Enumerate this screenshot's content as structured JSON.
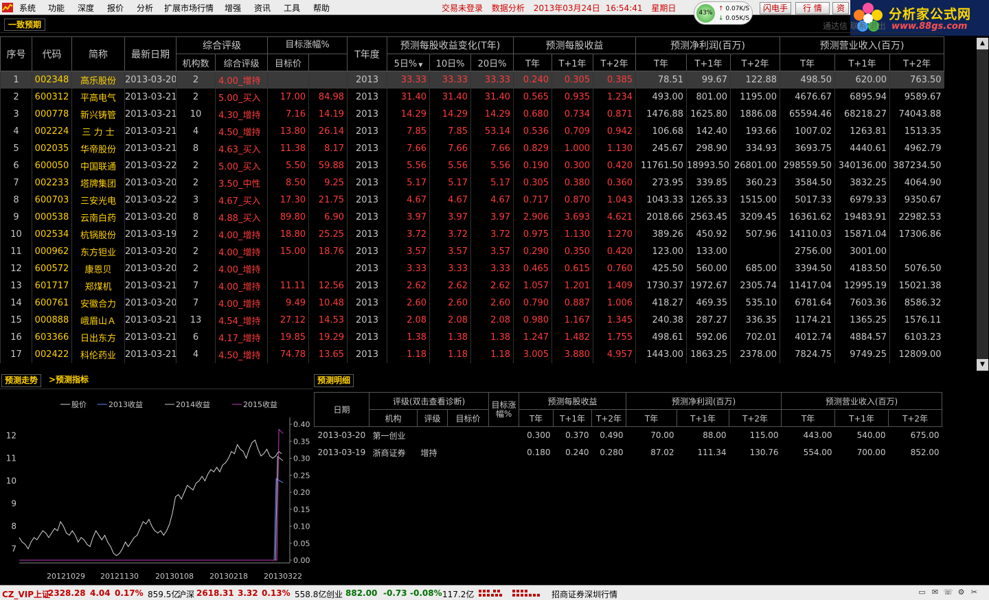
{
  "menu": [
    "系统",
    "功能",
    "深度",
    "报价",
    "分析",
    "扩展市场行情",
    "增强",
    "资讯",
    "工具",
    "帮助"
  ],
  "top_status": {
    "login": "交易未登录",
    "mode": "数据分析",
    "date": "2013年03月24日",
    "time": "16:54:41",
    "weekday": "星期日"
  },
  "network": {
    "percent": "43%",
    "up": "0.07K/S",
    "down": "0.05K/S"
  },
  "top_buttons": [
    "闪电手",
    "行 情",
    "资"
  ],
  "brand": {
    "name": "分析家公式网",
    "url": "www.88gs.com"
  },
  "top_right_links": "通达信 联系 退出",
  "panel_title": "一致预期",
  "table_headers": {
    "seq": "序号",
    "code": "代码",
    "name": "简称",
    "date": "最新日期",
    "rating": "综合评级",
    "target": "目标涨幅%",
    "tyear": "T年度",
    "eps_change": "预测每股收益变化(T年)",
    "eps": "预测每股收益",
    "net_profit": "预测净利润(百万)",
    "revenue": "预测营业收入(百万)",
    "institutions": "机构数",
    "rating_sub": "综合评级",
    "target_price": "目标价",
    "d5": "5日%",
    "d10": "10日%",
    "d20": "20日%",
    "t": "T年",
    "t1": "T+1年",
    "t2": "T+2年"
  },
  "rows": [
    {
      "seq": "1",
      "code": "002348",
      "name": "高乐股份",
      "date": "2013-03-20",
      "inst": "2",
      "rating": "4.00_增持",
      "tprice": "",
      "tgain": "",
      "year": "2013",
      "d5": "33.33",
      "d10": "33.33",
      "d20": "33.33",
      "eps_t": "0.240",
      "eps_t1": "0.305",
      "eps_t2": "0.385",
      "np_t": "78.51",
      "np_t1": "99.67",
      "np_t2": "122.88",
      "rv_t": "498.50",
      "rv_t1": "620.00",
      "rv_t2": "763.50"
    },
    {
      "seq": "2",
      "code": "600312",
      "name": "平高电气",
      "date": "2013-03-21",
      "inst": "2",
      "rating": "5.00_买入",
      "tprice": "17.00",
      "tgain": "84.98",
      "year": "2013",
      "d5": "31.40",
      "d10": "31.40",
      "d20": "31.40",
      "eps_t": "0.565",
      "eps_t1": "0.935",
      "eps_t2": "1.234",
      "np_t": "493.00",
      "np_t1": "801.00",
      "np_t2": "1195.00",
      "rv_t": "4676.67",
      "rv_t1": "6895.94",
      "rv_t2": "9589.67"
    },
    {
      "seq": "3",
      "code": "000778",
      "name": "新兴铸管",
      "date": "2013-03-21",
      "inst": "10",
      "rating": "4.30_增持",
      "tprice": "7.16",
      "tgain": "14.19",
      "year": "2013",
      "d5": "14.29",
      "d10": "14.29",
      "d20": "14.29",
      "eps_t": "0.680",
      "eps_t1": "0.734",
      "eps_t2": "0.871",
      "np_t": "1476.88",
      "np_t1": "1625.80",
      "np_t2": "1886.08",
      "rv_t": "65594.46",
      "rv_t1": "68218.27",
      "rv_t2": "74043.88"
    },
    {
      "seq": "4",
      "code": "002224",
      "name": "三 力 士",
      "date": "2013-03-21",
      "inst": "4",
      "rating": "4.50_增持",
      "tprice": "13.80",
      "tgain": "26.14",
      "year": "2013",
      "d5": "7.85",
      "d10": "7.85",
      "d20": "53.14",
      "eps_t": "0.536",
      "eps_t1": "0.709",
      "eps_t2": "0.942",
      "np_t": "106.68",
      "np_t1": "142.40",
      "np_t2": "193.66",
      "rv_t": "1007.02",
      "rv_t1": "1263.81",
      "rv_t2": "1513.35"
    },
    {
      "seq": "5",
      "code": "002035",
      "name": "华帝股份",
      "date": "2013-03-21",
      "inst": "8",
      "rating": "4.63_买入",
      "tprice": "11.38",
      "tgain": "8.17",
      "year": "2013",
      "d5": "7.66",
      "d10": "7.66",
      "d20": "7.66",
      "eps_t": "0.829",
      "eps_t1": "1.000",
      "eps_t2": "1.130",
      "np_t": "245.67",
      "np_t1": "298.90",
      "np_t2": "334.93",
      "rv_t": "3693.75",
      "rv_t1": "4440.61",
      "rv_t2": "4962.79"
    },
    {
      "seq": "6",
      "code": "600050",
      "name": "中国联通",
      "date": "2013-03-22",
      "inst": "2",
      "rating": "5.00_买入",
      "tprice": "5.50",
      "tgain": "59.88",
      "year": "2013",
      "d5": "5.56",
      "d10": "5.56",
      "d20": "5.56",
      "eps_t": "0.190",
      "eps_t1": "0.300",
      "eps_t2": "0.420",
      "np_t": "11761.50",
      "np_t1": "18993.50",
      "np_t2": "26801.00",
      "rv_t": "298559.50",
      "rv_t1": "340136.00",
      "rv_t2": "387234.50"
    },
    {
      "seq": "7",
      "code": "002233",
      "name": "塔牌集团",
      "date": "2013-03-20",
      "inst": "2",
      "rating": "3.50_中性",
      "tprice": "8.50",
      "tgain": "9.25",
      "year": "2013",
      "d5": "5.17",
      "d10": "5.17",
      "d20": "5.17",
      "eps_t": "0.305",
      "eps_t1": "0.380",
      "eps_t2": "0.360",
      "np_t": "273.95",
      "np_t1": "339.85",
      "np_t2": "360.23",
      "rv_t": "3584.50",
      "rv_t1": "3832.25",
      "rv_t2": "4064.90"
    },
    {
      "seq": "8",
      "code": "600703",
      "name": "三安光电",
      "date": "2013-03-22",
      "inst": "3",
      "rating": "4.67_买入",
      "tprice": "17.30",
      "tgain": "21.75",
      "year": "2013",
      "d5": "4.67",
      "d10": "4.67",
      "d20": "4.67",
      "eps_t": "0.717",
      "eps_t1": "0.870",
      "eps_t2": "1.043",
      "np_t": "1043.33",
      "np_t1": "1265.33",
      "np_t2": "1515.00",
      "rv_t": "5017.33",
      "rv_t1": "6979.33",
      "rv_t2": "9350.67"
    },
    {
      "seq": "9",
      "code": "000538",
      "name": "云南白药",
      "date": "2013-03-20",
      "inst": "8",
      "rating": "4.88_买入",
      "tprice": "89.80",
      "tgain": "6.90",
      "year": "2013",
      "d5": "3.97",
      "d10": "3.97",
      "d20": "3.97",
      "eps_t": "2.906",
      "eps_t1": "3.693",
      "eps_t2": "4.621",
      "np_t": "2018.66",
      "np_t1": "2563.45",
      "np_t2": "3209.45",
      "rv_t": "16361.62",
      "rv_t1": "19483.91",
      "rv_t2": "22982.53"
    },
    {
      "seq": "10",
      "code": "002534",
      "name": "杭锅股份",
      "date": "2013-03-19",
      "inst": "2",
      "rating": "4.00_增持",
      "tprice": "18.80",
      "tgain": "25.25",
      "year": "2013",
      "d5": "3.72",
      "d10": "3.72",
      "d20": "3.72",
      "eps_t": "0.975",
      "eps_t1": "1.130",
      "eps_t2": "1.270",
      "np_t": "389.26",
      "np_t1": "450.92",
      "np_t2": "507.96",
      "rv_t": "14110.03",
      "rv_t1": "15871.04",
      "rv_t2": "17306.86"
    },
    {
      "seq": "11",
      "code": "000962",
      "name": "东方钽业",
      "date": "2013-03-20",
      "inst": "2",
      "rating": "4.00_增持",
      "tprice": "15.00",
      "tgain": "18.76",
      "year": "2013",
      "d5": "3.57",
      "d10": "3.57",
      "d20": "3.57",
      "eps_t": "0.290",
      "eps_t1": "0.350",
      "eps_t2": "0.420",
      "np_t": "123.00",
      "np_t1": "133.00",
      "np_t2": "",
      "rv_t": "2756.00",
      "rv_t1": "3001.00",
      "rv_t2": ""
    },
    {
      "seq": "12",
      "code": "600572",
      "name": "康恩贝",
      "date": "2013-03-20",
      "inst": "2",
      "rating": "4.00_增持",
      "tprice": "",
      "tgain": "",
      "year": "2013",
      "d5": "3.33",
      "d10": "3.33",
      "d20": "3.33",
      "eps_t": "0.465",
      "eps_t1": "0.615",
      "eps_t2": "0.760",
      "np_t": "425.50",
      "np_t1": "560.00",
      "np_t2": "685.00",
      "rv_t": "3394.50",
      "rv_t1": "4183.50",
      "rv_t2": "5076.50"
    },
    {
      "seq": "13",
      "code": "601717",
      "name": "郑煤机",
      "date": "2013-03-21",
      "inst": "7",
      "rating": "4.00_增持",
      "tprice": "11.11",
      "tgain": "12.56",
      "year": "2013",
      "d5": "2.62",
      "d10": "2.62",
      "d20": "2.62",
      "eps_t": "1.057",
      "eps_t1": "1.201",
      "eps_t2": "1.409",
      "np_t": "1730.37",
      "np_t1": "1972.67",
      "np_t2": "2305.74",
      "rv_t": "11417.04",
      "rv_t1": "12995.19",
      "rv_t2": "15021.38"
    },
    {
      "seq": "14",
      "code": "600761",
      "name": "安徽合力",
      "date": "2013-03-20",
      "inst": "7",
      "rating": "4.00_增持",
      "tprice": "9.49",
      "tgain": "10.48",
      "year": "2013",
      "d5": "2.60",
      "d10": "2.60",
      "d20": "2.60",
      "eps_t": "0.790",
      "eps_t1": "0.887",
      "eps_t2": "1.006",
      "np_t": "418.27",
      "np_t1": "469.35",
      "np_t2": "535.10",
      "rv_t": "6781.64",
      "rv_t1": "7603.36",
      "rv_t2": "8586.32"
    },
    {
      "seq": "15",
      "code": "000888",
      "name": "峨眉山Ａ",
      "date": "2013-03-21",
      "inst": "13",
      "rating": "4.54_增持",
      "tprice": "27.12",
      "tgain": "14.53",
      "year": "2013",
      "d5": "2.08",
      "d10": "2.08",
      "d20": "2.08",
      "eps_t": "0.980",
      "eps_t1": "1.167",
      "eps_t2": "1.345",
      "np_t": "240.38",
      "np_t1": "287.27",
      "np_t2": "336.35",
      "rv_t": "1174.21",
      "rv_t1": "1365.25",
      "rv_t2": "1576.11"
    },
    {
      "seq": "16",
      "code": "603366",
      "name": "日出东方",
      "date": "2013-03-21",
      "inst": "6",
      "rating": "4.17_增持",
      "tprice": "19.85",
      "tgain": "19.29",
      "year": "2013",
      "d5": "1.38",
      "d10": "1.38",
      "d20": "1.38",
      "eps_t": "1.247",
      "eps_t1": "1.482",
      "eps_t2": "1.755",
      "np_t": "498.61",
      "np_t1": "592.06",
      "np_t2": "702.01",
      "rv_t": "4012.74",
      "rv_t1": "4884.57",
      "rv_t2": "6103.23"
    },
    {
      "seq": "17",
      "code": "002422",
      "name": "科伦药业",
      "date": "2013-03-21",
      "inst": "4",
      "rating": "4.50_增持",
      "tprice": "74.78",
      "tgain": "13.65",
      "year": "2013",
      "d5": "1.18",
      "d10": "1.18",
      "d20": "1.18",
      "eps_t": "3.005",
      "eps_t1": "3.880",
      "eps_t2": "4.957",
      "np_t": "1443.00",
      "np_t1": "1863.25",
      "np_t2": "2378.00",
      "rv_t": "7824.75",
      "rv_t1": "9749.25",
      "rv_t2": "12809.00"
    }
  ],
  "left_tabs": {
    "trend": "预测走势",
    "index": ">预测指标"
  },
  "detail": {
    "tab": "预测明细",
    "headers": {
      "date": "日期",
      "rating": "评级(双击查看诊断)",
      "target": "目标涨幅%",
      "eps": "预测每股收益",
      "np": "预测净利润(百万)",
      "rv": "预测营业收入(百万)",
      "inst": "机构",
      "grade": "评级",
      "tprice": "目标价",
      "t": "T年",
      "t1": "T+1年",
      "t2": "T+2年"
    },
    "rows": [
      {
        "date": "2013-03-20",
        "inst": "第一创业",
        "grade": "",
        "tprice": "",
        "tgain": "",
        "eps_t": "0.300",
        "eps_t1": "0.370",
        "eps_t2": "0.490",
        "np_t": "70.00",
        "np_t1": "88.00",
        "np_t2": "115.00",
        "rv_t": "443.00",
        "rv_t1": "540.00",
        "rv_t2": "675.00"
      },
      {
        "date": "2013-03-19",
        "inst": "浙商证券",
        "grade": "增持",
        "tprice": "",
        "tgain": "",
        "eps_t": "0.180",
        "eps_t1": "0.240",
        "eps_t2": "0.280",
        "np_t": "87.02",
        "np_t1": "111.34",
        "np_t2": "130.76",
        "rv_t": "554.00",
        "rv_t1": "700.00",
        "rv_t2": "852.00"
      }
    ]
  },
  "chart_data": {
    "type": "line",
    "legend": [
      "股价",
      "2013收益",
      "2014收益",
      "2015收益"
    ],
    "colors": {
      "股价": "#d8d8d8",
      "2013收益": "#6f86ff",
      "2014收益": "#c8c8c8",
      "2015收益": "#c040c0"
    },
    "x_ticks": [
      "20121029",
      "20121130",
      "20130108",
      "20130218",
      "20130322"
    ],
    "y_left_ticks": [
      "12",
      "11",
      "10",
      "9",
      "8",
      "7"
    ],
    "y_right_ticks": [
      "0.40",
      "0.35",
      "0.30",
      "0.25",
      "0.20",
      "0.15",
      "0.10",
      "0.05",
      "0.00"
    ],
    "ylim_left": [
      6.5,
      12.5
    ],
    "ylim_right": [
      0,
      0.4
    ],
    "price": [
      7.5,
      7.3,
      7.2,
      7.0,
      7.3,
      7.5,
      7.4,
      7.6,
      7.8,
      7.7,
      7.5,
      7.7,
      7.9,
      7.8,
      8.2,
      8.0,
      7.7,
      7.6,
      7.8,
      7.6,
      7.3,
      7.5,
      7.4,
      7.2,
      7.1,
      7.5,
      7.8,
      7.6,
      7.4,
      7.6,
      7.3,
      7.1,
      6.8,
      6.7,
      6.8,
      7.0,
      7.3,
      7.1,
      7.3,
      7.5,
      7.6,
      7.9,
      8.2,
      8.1,
      8.3,
      8.0,
      7.8,
      7.7,
      7.8,
      7.6,
      7.8,
      8.1,
      8.6,
      9.3,
      9.4,
      9.2,
      9.5,
      9.8,
      9.7,
      9.6,
      9.9,
      10.0,
      10.2,
      10.0,
      10.3,
      10.5,
      10.4,
      10.6,
      10.4,
      10.7,
      10.8,
      11.0,
      11.3,
      11.2,
      11.6,
      11.4,
      11.3,
      11.0,
      11.4,
      11.7,
      11.8,
      11.4,
      11.1,
      11.2,
      11.4,
      11.1,
      11.0,
      11.1,
      11.3,
      11.2
    ],
    "eps2013": {
      "flat": 0.0,
      "end": 0.24
    },
    "eps2014": {
      "flat": 0.0,
      "end": 0.305
    },
    "eps2015": {
      "flat": 0.0,
      "end": 0.385
    }
  },
  "statusbar": {
    "sh_label": "CZ_VIP上证",
    "sh_value": "2328.28",
    "sh_chg": "4.04",
    "sh_pct": "0.17%",
    "sh_amt": "859.5亿",
    "sz_label": "沪深",
    "sz_value": "2618.31",
    "sz_chg": "3.32",
    "sz_pct": "0.13%",
    "sz_amt": "558.8亿",
    "cy_label": "创业",
    "cy_value": "882.00",
    "cy_chg": "-0.73",
    "cy_pct": "-0.08%",
    "cy_amt": "117.2亿",
    "feed": "招商证券深圳行情"
  }
}
